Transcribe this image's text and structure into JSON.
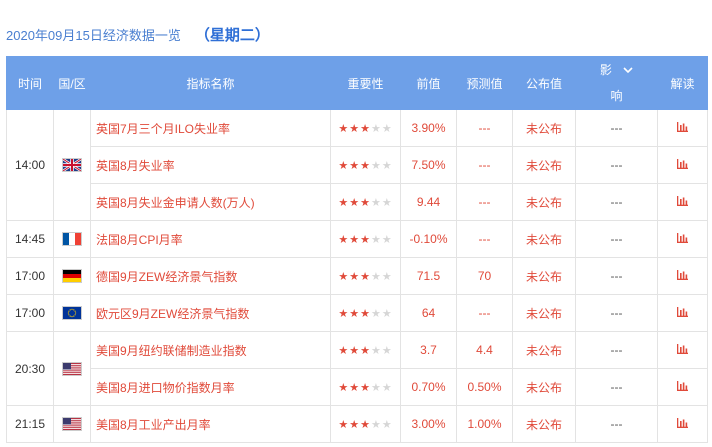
{
  "header": {
    "date_title": "2020年09月15日经济数据一览",
    "weekday": "（星期二）"
  },
  "columns": {
    "time": "时间",
    "country": "国/区",
    "indicator": "指标名称",
    "importance": "重要性",
    "previous": "前值",
    "forecast": "预测值",
    "published": "公布值",
    "impact_line1": "影",
    "impact_line2": "响",
    "interpret": "解读"
  },
  "colors": {
    "header_bg": "#6ea0e8",
    "red": "#e04a3a",
    "date_blue": "#4a7fd0"
  },
  "groups": [
    {
      "time": "14:00",
      "flag": "uk-flag",
      "rows": [
        {
          "name": "英国7月三个月ILO失业率",
          "stars": 3,
          "prev": "3.90%",
          "fore": "---",
          "pub": "未公布",
          "impact": "---"
        },
        {
          "name": "英国8月失业率",
          "stars": 3,
          "prev": "7.50%",
          "fore": "---",
          "pub": "未公布",
          "impact": "---"
        },
        {
          "name": "英国8月失业金申请人数(万人)",
          "stars": 3,
          "prev": "9.44",
          "fore": "---",
          "pub": "未公布",
          "impact": "---"
        }
      ]
    },
    {
      "time": "14:45",
      "flag": "france-flag",
      "rows": [
        {
          "name": "法国8月CPI月率",
          "stars": 3,
          "prev": "-0.10%",
          "fore": "---",
          "pub": "未公布",
          "impact": "---"
        }
      ]
    },
    {
      "time": "17:00",
      "flag": "germany-flag",
      "rows": [
        {
          "name": "德国9月ZEW经济景气指数",
          "stars": 3,
          "prev": "71.5",
          "fore": "70",
          "pub": "未公布",
          "impact": "---"
        }
      ]
    },
    {
      "time": "17:00",
      "flag": "eu-flag",
      "rows": [
        {
          "name": "欧元区9月ZEW经济景气指数",
          "stars": 3,
          "prev": "64",
          "fore": "---",
          "pub": "未公布",
          "impact": "---"
        }
      ]
    },
    {
      "time": "20:30",
      "flag": "us-flag",
      "rows": [
        {
          "name": "美国9月纽约联储制造业指数",
          "stars": 3,
          "prev": "3.7",
          "fore": "4.4",
          "pub": "未公布",
          "impact": "---"
        },
        {
          "name": "美国8月进口物价指数月率",
          "stars": 3,
          "prev": "0.70%",
          "fore": "0.50%",
          "pub": "未公布",
          "impact": "---"
        }
      ]
    },
    {
      "time": "21:15",
      "flag": "us-flag",
      "rows": [
        {
          "name": "美国8月工业产出月率",
          "stars": 3,
          "prev": "3.00%",
          "fore": "1.00%",
          "pub": "未公布",
          "impact": "---"
        }
      ]
    }
  ]
}
